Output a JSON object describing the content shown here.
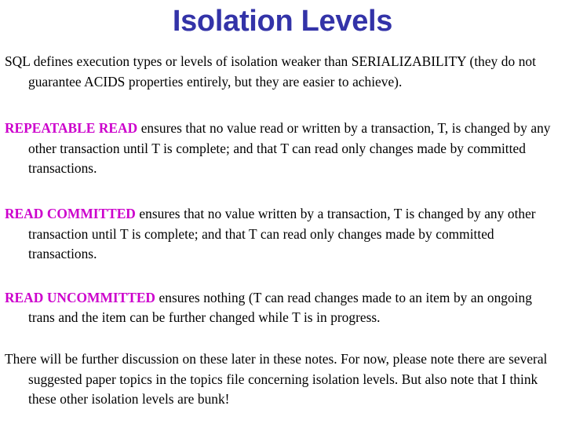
{
  "slide": {
    "title": "Isolation Levels",
    "title_color": "#3333a8",
    "lead_color": "#cc00cc",
    "body_color": "#000000",
    "background_color": "#ffffff"
  },
  "paragraphs": [
    {
      "lead": "",
      "text": "SQL defines execution types or levels of isolation weaker than SERIALIZABILITY (they do not guarantee ACIDS properties entirely, but they are easier to achieve)."
    },
    {
      "lead": "REPEATABLE READ",
      "text": " ensures that no value read or written by a transaction, T, is changed by any other transaction until T is complete; and that T can read only changes made by committed transactions."
    },
    {
      "lead": "READ COMMITTED",
      "text": " ensures that no value written by a transaction, T is changed by any other transaction until T is complete; and that T can read only changes made by committed transactions."
    },
    {
      "lead": "READ UNCOMMITTED",
      "text": " ensures nothing (T can read changes made to an item by an ongoing trans and the item can be further changed while T is in progress."
    },
    {
      "lead": "",
      "text": "There will be further discussion on these later in these notes.  For now, please note there are several suggested paper topics in the topics file concerning isolation levels.  But also note that I think these other isolation levels are bunk!"
    }
  ]
}
